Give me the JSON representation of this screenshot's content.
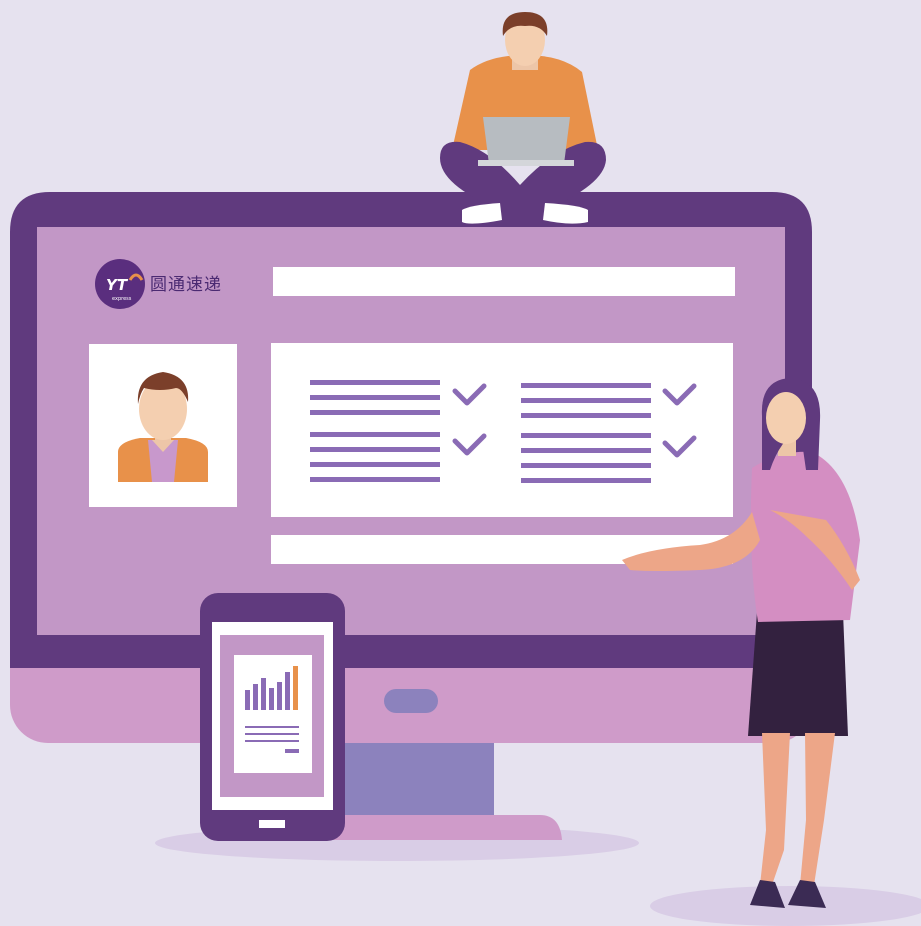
{
  "brand": {
    "logo_mark": "YT",
    "logo_sub": "express",
    "name_cn": "圆通速递"
  },
  "colors": {
    "background": "#e6e2ef",
    "monitor_frame": "#603a7e",
    "screen": "#c297c6",
    "monitor_base": "#cf9bc9",
    "stand": "#8c82bd",
    "list_line": "#8a6bb5",
    "accent_orange": "#e8914a"
  },
  "icons": {
    "avatar": "user-avatar-icon",
    "check": "checkmark-icon",
    "chart": "bar-chart-icon"
  }
}
